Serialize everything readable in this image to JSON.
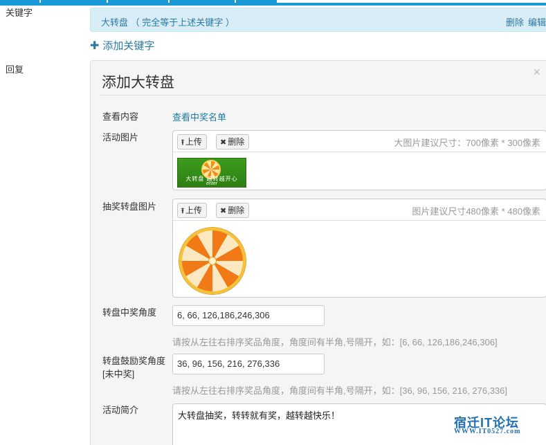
{
  "left_labels": {
    "keyword": "关键字",
    "reply": "回复"
  },
  "keyword_row": {
    "text": "大转盘 （ 完全等于上述关键字 ）",
    "delete": "删除",
    "edit": "编辑"
  },
  "add_keyword": "添加关键字",
  "panel": {
    "title": "添加大转盘",
    "close": "×",
    "view_content_label": "查看内容",
    "view_winners_link": "查看中奖名单",
    "activity_image": {
      "label": "活动图片",
      "upload": "上传",
      "delete": "删除",
      "hint": "大图片建议尺寸：700像素 * 300像素",
      "banner_text": "大转盘 越转越开心",
      "banner_enter": "enter"
    },
    "wheel_image": {
      "label": "抽奖转盘图片",
      "upload": "上传",
      "delete": "删除",
      "hint": "图片建议尺寸480像素 * 480像素"
    },
    "win_angle": {
      "label": "转盘中奖角度",
      "value": "6, 66, 126,186,246,306",
      "help": "请按从左往右排序奖品角度，角度间有半角,号隔开，如：[6, 66, 126,186,246,306]"
    },
    "consolation_angle": {
      "label_line1": "转盘鼓励奖角度",
      "label_line2": "[未中奖]",
      "value": "36, 96, 156, 216, 276,336",
      "help": "请按从左往右排序奖品角度，角度间有半角,号隔开，如：[36, 96, 156, 216, 276,336]"
    },
    "intro": {
      "label": "活动简介",
      "value": "大转盘抽奖，转转就有奖，越转越快乐！"
    }
  },
  "watermark": {
    "line1": "宿迁IT论坛",
    "line2": "WWW.IT0527.com"
  }
}
